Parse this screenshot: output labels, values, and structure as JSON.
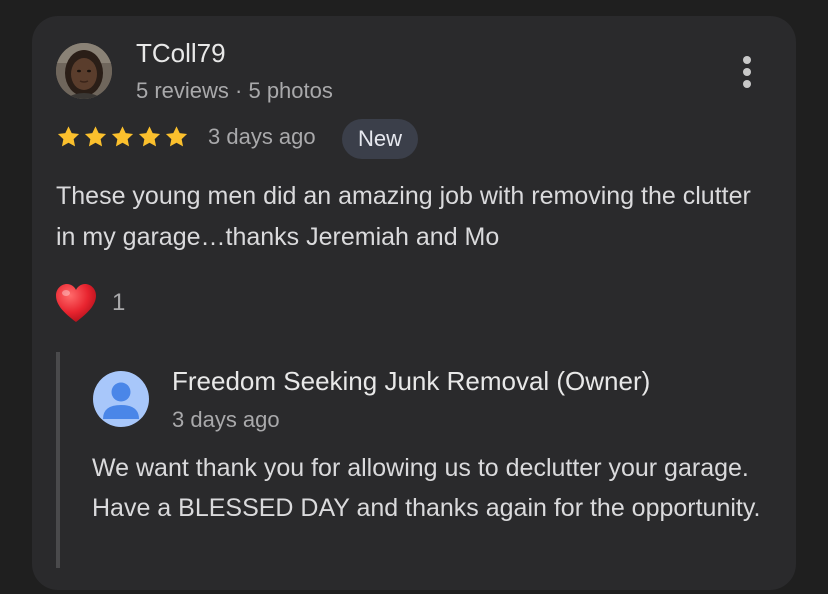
{
  "review": {
    "reviewer_name": "TColl79",
    "reviewer_meta": "5 reviews · 5 photos",
    "rating": 5,
    "date": "3 days ago",
    "badge": "New",
    "text": "These young men did an amazing job with removing the clutter in my garage…thanks Jeremiah and Mo",
    "reaction_icon": "heart-icon",
    "reaction_count": "1"
  },
  "owner_reply": {
    "name": "Freedom Seeking Junk Removal (Owner)",
    "date": "3 days ago",
    "text": "We want thank you for allowing us to declutter your garage. Have a BLESSED DAY and thanks again for the opportunity."
  },
  "colors": {
    "background": "#1f1f1f",
    "card": "#2a2a2c",
    "star": "#fbc02d",
    "heart": "#e8242f",
    "badge_bg": "#3b3f4a",
    "owner_avatar_bg": "#a8c7fa",
    "owner_avatar_fg": "#4a86e8"
  }
}
